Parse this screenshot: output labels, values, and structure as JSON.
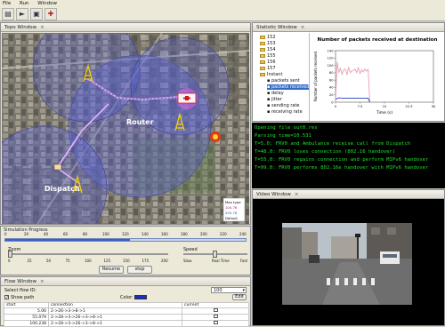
{
  "menu": [
    "File",
    "Run",
    "Window"
  ],
  "topo": {
    "title": "Topo Window",
    "router_label": "Router",
    "dispatch_label": "Dispatch",
    "legend": [
      "Max type",
      "100.76",
      "200.76",
      "Default"
    ]
  },
  "stats": {
    "title": "Statistic Window",
    "tree": [
      "152",
      "153",
      "154",
      "155",
      "156",
      "157",
      "Instant",
      "packets sent",
      "packets received",
      "delay",
      "jitter",
      "sending rate",
      "receiving rate"
    ],
    "selected_index": 8,
    "chart_data": {
      "type": "line",
      "title": "Number of packets received at destination",
      "xlabel": "Time (s)",
      "ylabel": "Number of packets received",
      "xticks": [
        "0",
        "7.5",
        "15",
        "22.5",
        "30"
      ],
      "yticks": [
        "0",
        "20",
        "40",
        "60",
        "80",
        "100",
        "120",
        "140"
      ],
      "ylim": [
        0,
        140
      ],
      "xlim": [
        0,
        30
      ],
      "series": [
        {
          "color": "#e8a0b0",
          "x": [
            0,
            0.5,
            1,
            1.5,
            2,
            2.5,
            3,
            3.5,
            4,
            4.5,
            5,
            5.5,
            6,
            6.5,
            7,
            7.5,
            8,
            8.5,
            9,
            9.5,
            10,
            10.5
          ],
          "values": [
            0,
            110,
            80,
            92,
            76,
            88,
            90,
            74,
            95,
            80,
            85,
            86,
            90,
            80,
            94,
            78,
            88,
            82,
            90,
            84,
            89,
            0
          ]
        },
        {
          "color": "#2040c0",
          "x": [
            0,
            0.5,
            1,
            2,
            3,
            4,
            5,
            6,
            7,
            8,
            9,
            10,
            10.5
          ],
          "values": [
            8,
            10,
            12,
            11,
            11,
            11,
            11,
            11,
            11,
            11,
            11,
            11,
            0
          ]
        }
      ]
    }
  },
  "terminal": [
    "Opening file out0.res",
    "Parsing time=10.531",
    "T=5.0: FRV0 and Ambulance receive call from Dispatch",
    "T=48.0: FRV0 loses connection (802.16 handover)",
    "T=55.0: FRV0 regains connection and perform MIPv6 handover",
    "T=99.0: FRV0 performs 802.16e handover with MIPv6 handover"
  ],
  "video": {
    "title": "Video Window"
  },
  "progress": {
    "label": "Simulation Progress",
    "ticks": [
      "0",
      "20",
      "40",
      "60",
      "80",
      "100",
      "120",
      "140",
      "160",
      "180",
      "200",
      "220",
      "240"
    ],
    "value": 0.52
  },
  "zoom": {
    "label": "Zoom",
    "ticks": [
      "0",
      "25",
      "50",
      "75",
      "100",
      "125",
      "150",
      "175",
      "200"
    ]
  },
  "speed": {
    "label": "Speed",
    "ticks": [
      "Slow",
      "Real Time",
      "Fast"
    ]
  },
  "buttons": {
    "resume": "Resume",
    "stop": "stop"
  },
  "flow": {
    "title": "Flow Window",
    "select_label": "Select flow ID:",
    "select_value": "100",
    "show_path": "Show path",
    "color_label": "Color:",
    "color": "#1a2ec8",
    "edit": "Edit",
    "columns": [
      "start",
      "connection",
      "current"
    ],
    "rows": [
      [
        "5.06",
        "2->26->3->8->1",
        ""
      ],
      [
        "55.079",
        "2->28->3->26->3->8->1",
        ""
      ],
      [
        "100.238",
        "2->28->3->26->3->8->1",
        ""
      ]
    ]
  }
}
